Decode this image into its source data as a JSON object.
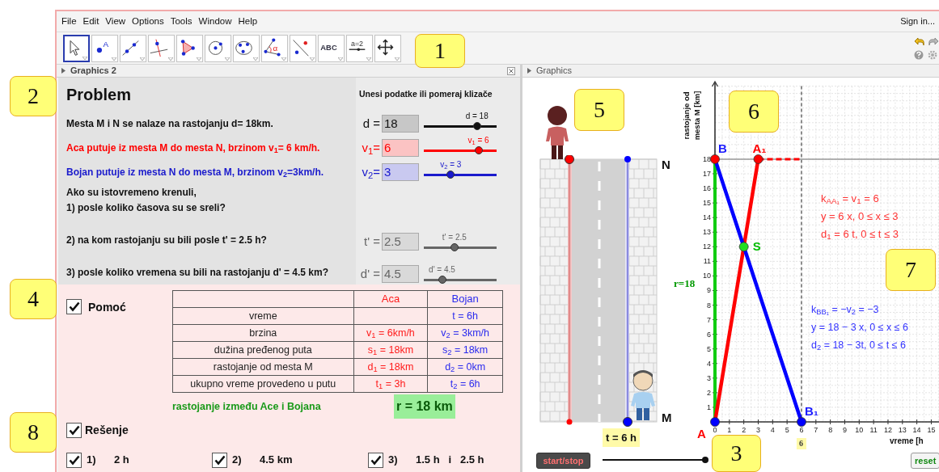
{
  "menu": [
    "File",
    "Edit",
    "View",
    "Options",
    "Tools",
    "Window",
    "Help"
  ],
  "sign_in": "Sign in...",
  "toolbar": [
    {
      "kind": "pointer",
      "selected": true
    },
    {
      "kind": "point",
      "text": "A",
      "selected": false
    },
    {
      "kind": "line",
      "selected": false
    },
    {
      "kind": "perpendicular",
      "selected": false
    },
    {
      "kind": "polygon",
      "selected": false
    },
    {
      "kind": "circle",
      "selected": false
    },
    {
      "kind": "conic",
      "selected": false
    },
    {
      "kind": "angle",
      "text": "α",
      "selected": false
    },
    {
      "kind": "reflect",
      "selected": false
    },
    {
      "kind": "text",
      "text": "ABC",
      "selected": false
    },
    {
      "kind": "slider",
      "text": "a=2",
      "selected": false
    },
    {
      "kind": "move",
      "selected": false
    }
  ],
  "panels": {
    "left": "Graphics 2",
    "right": "Graphics"
  },
  "problem": {
    "title": "Problem",
    "inputs_heading": "Unesi podatke ili pomeraj klizače",
    "lines": [
      {
        "kind": "given",
        "text": "Mesta M i N se nalaze na rastojanju  d= 18km.",
        "color": "#111111",
        "input": {
          "label": "d =",
          "value": "18",
          "slider_label": "d = 18",
          "level": 0.73,
          "color": "#111111"
        }
      },
      {
        "kind": "given",
        "text": "Aca putuje iz mesta M do mesta N, brzinom  v$_{1}$= 6 km/h.",
        "color": "#ff0000",
        "input": {
          "label": "v$_{1}$=",
          "value": "6",
          "slider_label": "v$_{1}$ = 6",
          "level": 0.75,
          "color": "#ff0000"
        }
      },
      {
        "kind": "given",
        "text": "Bojan putuje iz mesta N do mesta M, brzinom   v$_{2}$=3km/h.",
        "color": "#1a1acc",
        "input": {
          "label": "v$_{2}$=",
          "value": "3",
          "slider_label": "v$_{2}$ = 3",
          "level": 0.37,
          "color": "#1a1acc"
        }
      },
      {
        "kind": "text",
        "text": "Ako su istovremeno krenuli,",
        "color": "#111111"
      },
      {
        "kind": "question",
        "text": "1)  posle koliko časova su se sreli?",
        "color": "#111111"
      },
      {
        "kind": "question",
        "text": "2)  na kom rastojanju su bili posle t' =  2.5 h?",
        "color": "#111111",
        "input": {
          "label": "t' =",
          "value": "2.5",
          "slider_label": "t' = 2.5",
          "level": 0.42,
          "color": "#666666"
        }
      },
      {
        "kind": "question",
        "text": "3) posle koliko vremena su bili na rastojanju d' = 4.5 km?",
        "color": "#111111",
        "input": {
          "label": "d' =",
          "value": "4.5",
          "slider_label": "d' = 4.5",
          "level": 0.25,
          "color": "#666666"
        }
      }
    ]
  },
  "help": {
    "label": "Pomoć",
    "checked": true
  },
  "table": {
    "columns": [
      {},
      {
        "label": "Aca",
        "color": "#ff1a1a"
      },
      {
        "label": "Bojan",
        "color": "#2a2aee"
      }
    ],
    "rows": [
      [
        "vreme",
        null,
        "t = 6h"
      ],
      [
        "brzina",
        "v$_{1}$ = 6km/h",
        "v$_{2}$ = 3km/h"
      ],
      [
        "dužina pređenog puta",
        "s$_{1}$ = 18km",
        "s$_{2}$ = 18km"
      ],
      [
        "rastojanje od mesta M",
        "d$_{1}$ = 18km",
        "d$_{2}$ = 0km"
      ],
      [
        "ukupno vreme provedeno u putu",
        "t$_{1}$ = 3h",
        "t$_{2}$ = 6h"
      ]
    ]
  },
  "distance": {
    "label": "rastojanje između Ace i Bojana",
    "value": "r = 18 km"
  },
  "solution": {
    "label": "Rešenje",
    "checked": true
  },
  "answers": [
    {
      "number": "1)",
      "text": "2 h",
      "checked": true
    },
    {
      "number": "2)",
      "text": "4.5 km",
      "checked": true
    },
    {
      "number": "3)",
      "text": "1.5 h   i   2.5 h",
      "checked": true
    }
  ],
  "road": {
    "places": [
      {
        "kind": "top",
        "text": "N"
      },
      {
        "kind": "bottom",
        "text": "M"
      }
    ]
  },
  "animation": {
    "time_label": "t = 6 h",
    "button": "start/stop",
    "level": 1,
    "reset": "reset"
  },
  "graph": {
    "chart_data": {
      "type": "line",
      "xlabel": "vreme [h",
      "ylabel": "rastojanje od mesta M [km]",
      "x": [
        0,
        1,
        2,
        3,
        4,
        5,
        6
      ],
      "series": [
        {
          "color": "#ff0000",
          "values": [
            0,
            6,
            12,
            18,
            null,
            null,
            null
          ]
        },
        {
          "color": "#ff0000",
          "line_style": "dashed",
          "values": [
            null,
            null,
            null,
            18,
            18,
            18,
            18
          ]
        },
        {
          "color": "#0000ff",
          "values": [
            18,
            15,
            12,
            9,
            6,
            3,
            0
          ]
        }
      ],
      "xlim": [
        0,
        15.5
      ],
      "ylim": [
        0,
        23
      ],
      "grid": true,
      "xticks": [
        0,
        1,
        2,
        3,
        4,
        5,
        6,
        7,
        8,
        9,
        10,
        11,
        12,
        13,
        14,
        15
      ],
      "yticks": [
        1,
        2,
        3,
        4,
        5,
        6,
        7,
        8,
        9,
        10,
        11,
        12,
        13,
        14,
        15,
        16,
        17,
        18
      ],
      "ref_lines": [
        {
          "axis": "x",
          "value": 6,
          "line_style": "dashed",
          "color": "#444444"
        },
        {
          "axis": "y",
          "value": 18,
          "color": "#999999"
        }
      ],
      "annotations": [
        {
          "text": "A",
          "x": 0,
          "y": 0
        },
        {
          "text": "B",
          "x": 0,
          "y": 18
        },
        {
          "text": "A₁",
          "x": 3,
          "y": 18
        },
        {
          "text": "B₁",
          "x": 6,
          "y": 0
        },
        {
          "text": "S",
          "x": 2,
          "y": 12
        },
        "r=18",
        {
          "text": "6",
          "x": 6,
          "y": 0
        }
      ]
    },
    "equations": [
      {
        "color": "#ff3333",
        "lines": [
          "k$_{AA₁}$ = v$_{1}$ = 6",
          "y = 6 x,  0 ≤ x ≤ 3",
          "d$_{1}$ = 6 t,  0 ≤ t ≤ 3"
        ]
      },
      {
        "color": "#3333ff",
        "lines": [
          "k$_{BB₁}$ = −v$_{2}$ = −3",
          "y = 18 − 3 x,  0 ≤ x ≤ 6",
          "d$_{2}$ = 18 − 3t,  0 ≤ t ≤ 6"
        ]
      }
    ]
  },
  "callouts": [
    "1",
    "2",
    "3",
    "4",
    "5",
    "6",
    "7",
    "8"
  ]
}
